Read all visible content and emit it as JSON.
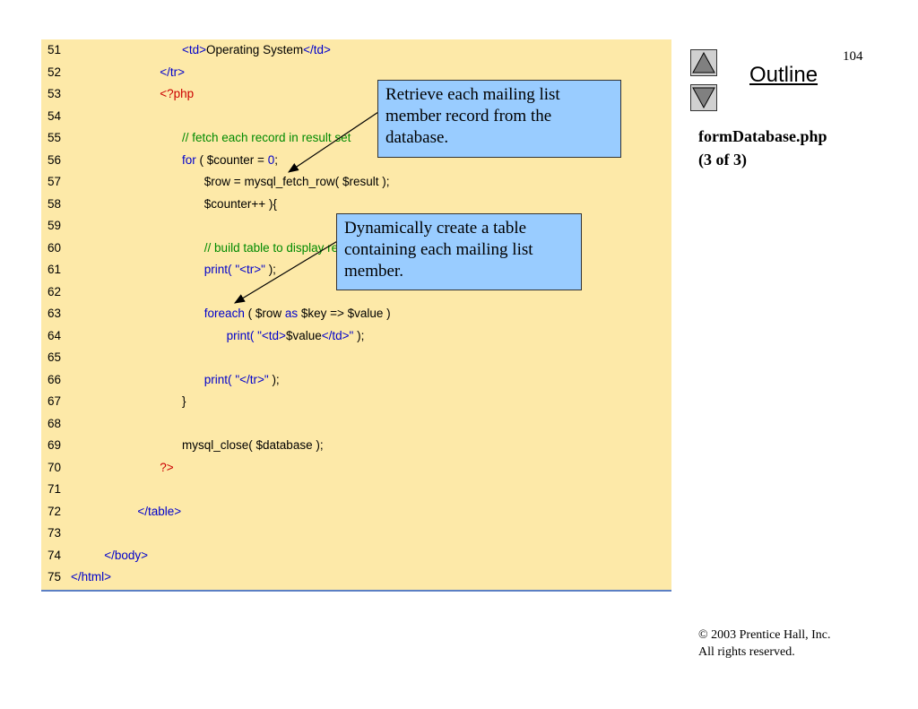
{
  "page_number": "104",
  "outline_label": "Outline",
  "file_name": "formDatabase.php",
  "part_label": "(3 of 3)",
  "copyright_line1": "© 2003 Prentice Hall, Inc.",
  "copyright_line2": "All rights reserved.",
  "callouts": [
    "Retrieve each mailing list member record from the database.",
    "Dynamically create a table containing each mailing list member."
  ],
  "code_lines": [
    {
      "n": "51",
      "indent": 10,
      "tokens": [
        {
          "t": "<td>",
          "c": "blue"
        },
        {
          "t": "Operating System",
          "c": "black"
        },
        {
          "t": "</td>",
          "c": "blue"
        }
      ]
    },
    {
      "n": "52",
      "indent": 8,
      "tokens": [
        {
          "t": "</tr>",
          "c": "blue"
        }
      ]
    },
    {
      "n": "53",
      "indent": 8,
      "tokens": [
        {
          "t": "<?php",
          "c": "red"
        }
      ]
    },
    {
      "n": "54",
      "indent": 0,
      "tokens": []
    },
    {
      "n": "55",
      "indent": 10,
      "tokens": [
        {
          "t": "// fetch each record in result set",
          "c": "green"
        }
      ]
    },
    {
      "n": "56",
      "indent": 10,
      "tokens": [
        {
          "t": "for",
          "c": "blue"
        },
        {
          "t": " ( $counter = ",
          "c": "black"
        },
        {
          "t": "0",
          "c": "blue"
        },
        {
          "t": ";",
          "c": "black"
        }
      ]
    },
    {
      "n": "57",
      "indent": 12,
      "tokens": [
        {
          "t": "$row = mysql_fetch_row( $result );",
          "c": "black"
        }
      ]
    },
    {
      "n": "58",
      "indent": 12,
      "tokens": [
        {
          "t": "$counter++ ){",
          "c": "black"
        }
      ]
    },
    {
      "n": "59",
      "indent": 0,
      "tokens": []
    },
    {
      "n": "60",
      "indent": 12,
      "tokens": [
        {
          "t": "// build table to display results",
          "c": "green"
        }
      ]
    },
    {
      "n": "61",
      "indent": 12,
      "tokens": [
        {
          "t": "print(",
          "c": "blue"
        },
        {
          "t": " ",
          "c": "black"
        },
        {
          "t": "\"<tr>\"",
          "c": "blue"
        },
        {
          "t": " );",
          "c": "black"
        }
      ]
    },
    {
      "n": "62",
      "indent": 0,
      "tokens": []
    },
    {
      "n": "63",
      "indent": 12,
      "tokens": [
        {
          "t": "foreach",
          "c": "blue"
        },
        {
          "t": " ( $row ",
          "c": "black"
        },
        {
          "t": "as",
          "c": "blue"
        },
        {
          "t": " $key => $value )",
          "c": "black"
        }
      ]
    },
    {
      "n": "64",
      "indent": 14,
      "tokens": [
        {
          "t": "print(",
          "c": "blue"
        },
        {
          "t": " ",
          "c": "black"
        },
        {
          "t": "\"<td>",
          "c": "blue"
        },
        {
          "t": "$value",
          "c": "black"
        },
        {
          "t": "</td>\"",
          "c": "blue"
        },
        {
          "t": " );",
          "c": "black"
        }
      ]
    },
    {
      "n": "65",
      "indent": 0,
      "tokens": []
    },
    {
      "n": "66",
      "indent": 12,
      "tokens": [
        {
          "t": "print(",
          "c": "blue"
        },
        {
          "t": " ",
          "c": "black"
        },
        {
          "t": "\"</tr>\"",
          "c": "blue"
        },
        {
          "t": " );",
          "c": "black"
        }
      ]
    },
    {
      "n": "67",
      "indent": 10,
      "tokens": [
        {
          "t": "}",
          "c": "black"
        }
      ]
    },
    {
      "n": "68",
      "indent": 0,
      "tokens": []
    },
    {
      "n": "69",
      "indent": 10,
      "tokens": [
        {
          "t": "mysql_close( $database );",
          "c": "black"
        }
      ]
    },
    {
      "n": "70",
      "indent": 8,
      "tokens": [
        {
          "t": "?>",
          "c": "red"
        }
      ]
    },
    {
      "n": "71",
      "indent": 0,
      "tokens": []
    },
    {
      "n": "72",
      "indent": 6,
      "tokens": [
        {
          "t": "</table>",
          "c": "blue"
        }
      ]
    },
    {
      "n": "73",
      "indent": 0,
      "tokens": []
    },
    {
      "n": "74",
      "indent": 3,
      "tokens": [
        {
          "t": "</body>",
          "c": "blue"
        }
      ]
    },
    {
      "n": "75",
      "indent": 0,
      "tokens": [
        {
          "t": "</html>",
          "c": "blue"
        }
      ]
    }
  ]
}
